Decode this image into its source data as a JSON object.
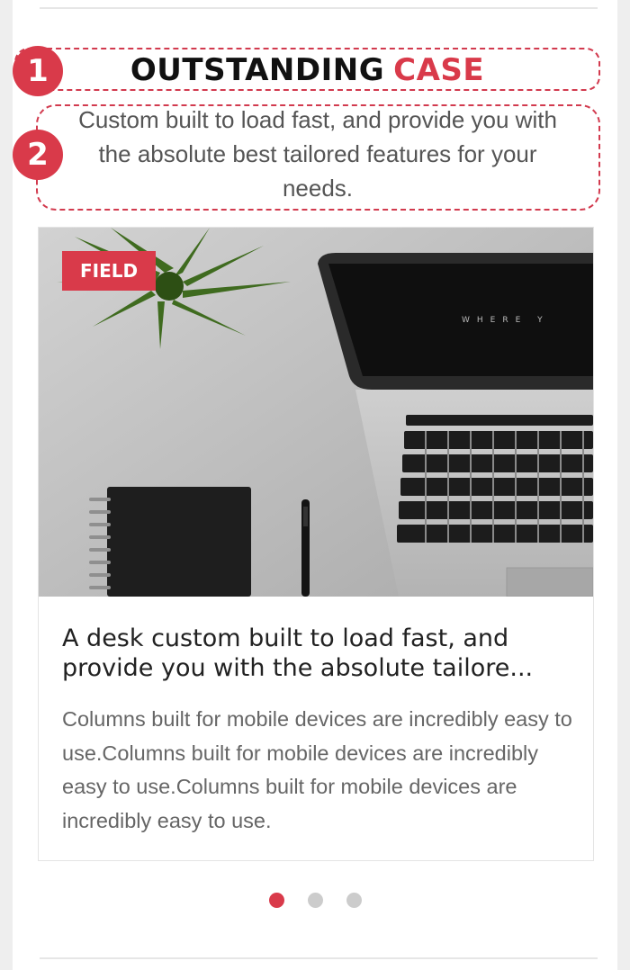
{
  "annotations": {
    "badge_1": "1",
    "badge_2": "2"
  },
  "section": {
    "title_main": "OUTSTANDING",
    "title_accent": "CASE",
    "subtitle": "Custom built to load fast, and provide you with the absolute best tailored features for your needs."
  },
  "card": {
    "tag": "FIELD",
    "title": "A desk custom built to load fast, and provide you with the absolute tailore...",
    "text": "Columns built for mobile devices are incredibly easy to use.Columns built for mobile devices are incredibly easy to use.Columns built for mobile devices are incredibly easy to use."
  },
  "pager": {
    "count": 3,
    "active": 0
  },
  "colors": {
    "accent": "#d93a4a",
    "text_dark": "#222222",
    "text_muted": "#666666"
  }
}
